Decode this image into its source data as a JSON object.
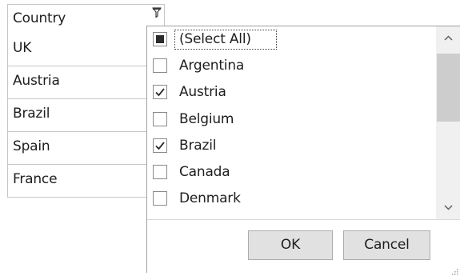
{
  "column": {
    "header": "Country",
    "filter_icon": "filter-icon",
    "rows": [
      "UK",
      "Austria",
      "Brazil",
      "Spain",
      "France"
    ]
  },
  "filter_popup": {
    "items": [
      {
        "label": "(Select All)",
        "state": "indeterminate"
      },
      {
        "label": "Argentina",
        "state": "unchecked"
      },
      {
        "label": "Austria",
        "state": "checked"
      },
      {
        "label": "Belgium",
        "state": "unchecked"
      },
      {
        "label": "Brazil",
        "state": "checked"
      },
      {
        "label": "Canada",
        "state": "unchecked"
      },
      {
        "label": "Denmark",
        "state": "unchecked"
      }
    ],
    "ok_label": "OK",
    "cancel_label": "Cancel",
    "scroll_up_icon": "chevron-up-icon",
    "scroll_down_icon": "chevron-down-icon",
    "resize_icon": "resize-grip-icon"
  },
  "colors": {
    "border": "#c6c6c6",
    "button_bg": "#e1e1e1",
    "scroll_thumb": "#cdcdcd",
    "scroll_track": "#f0f0f0"
  }
}
